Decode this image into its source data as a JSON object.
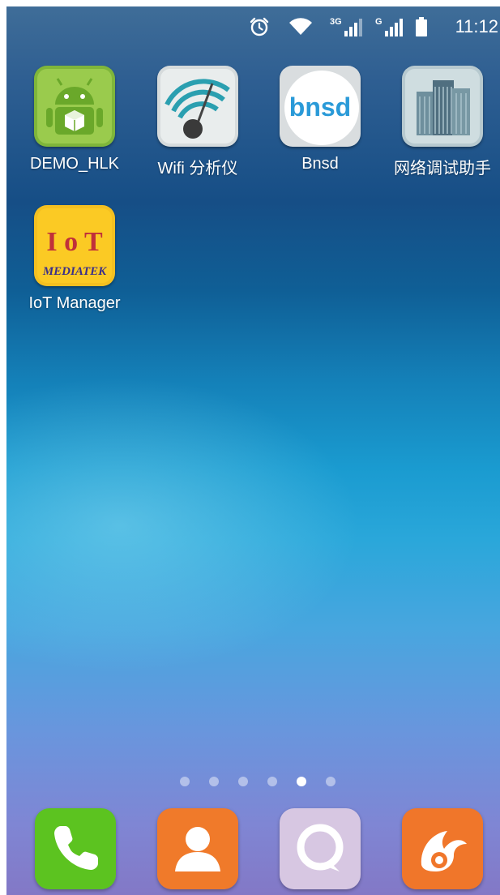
{
  "status_bar": {
    "icons": [
      "alarm-icon",
      "wifi-icon",
      "signal-3g-icon",
      "signal-g-icon",
      "battery-icon"
    ],
    "network_3g": "3G",
    "network_g": "G",
    "time": "11:12"
  },
  "home_apps": [
    {
      "label": "DEMO_HLK",
      "icon": "android-app-icon"
    },
    {
      "label": "Wifi 分析仪",
      "icon": "wifi-analyzer-icon"
    },
    {
      "label": "Bnsd",
      "icon": "bnsd-icon",
      "tile_text": "bnsd"
    },
    {
      "label": "网络调试助手",
      "icon": "network-debug-icon"
    },
    {
      "label": "IoT Manager",
      "icon": "iot-manager-icon",
      "tile_text_top": "I o T",
      "tile_text_bottom": "MEDIATEK"
    }
  ],
  "page_indicator": {
    "count": 6,
    "active_page": 5
  },
  "dock": [
    {
      "icon": "phone-icon",
      "color": "#5cc320"
    },
    {
      "icon": "contacts-icon",
      "color": "#f07a2a"
    },
    {
      "icon": "messaging-icon",
      "color": "#d7c7e2"
    },
    {
      "icon": "uc-browser-icon",
      "color": "#f0762a"
    }
  ],
  "colors": {
    "wallpaper_top": "#3f6d98",
    "wallpaper_mid": "#1a9bd0",
    "wallpaper_bottom": "#8378c6"
  }
}
